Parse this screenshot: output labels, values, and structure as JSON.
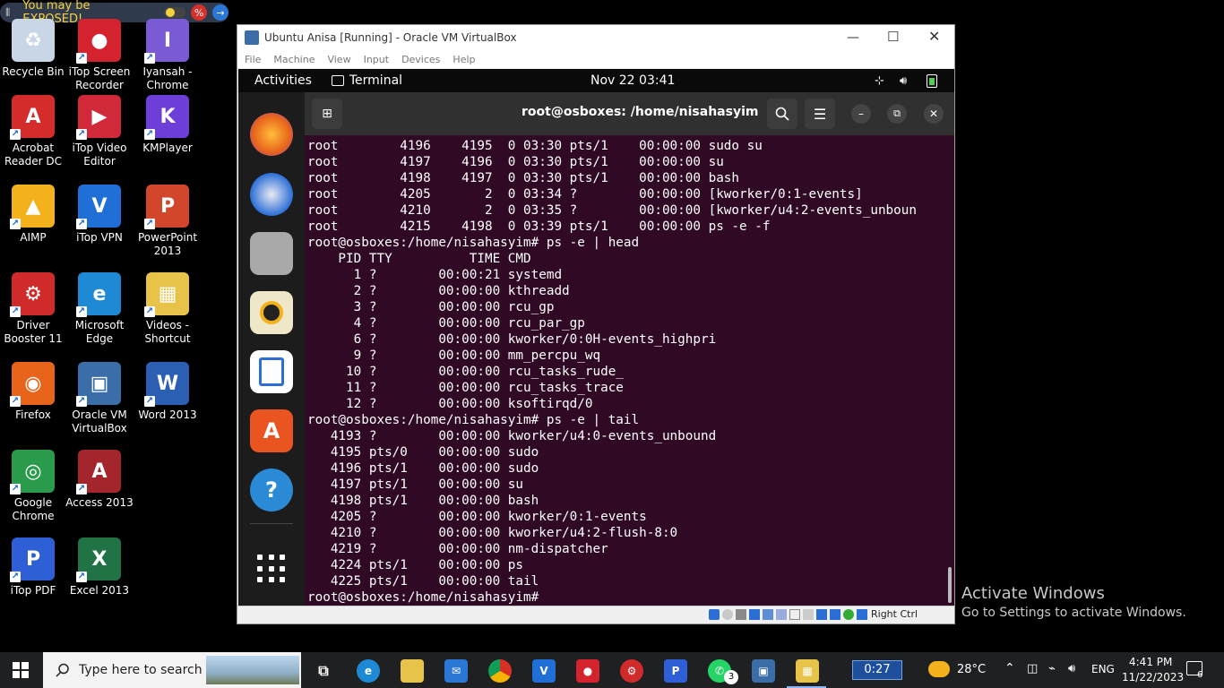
{
  "exposed_bar": {
    "text": "You may be EXPOSED!"
  },
  "desktop_icons": [
    {
      "label": "Recycle Bin",
      "glyph": "♻",
      "color": "#c9d6e6",
      "icon": "recycle-bin-icon"
    },
    {
      "label": "iTop Screen Recorder",
      "glyph": "●",
      "color": "#d4232e",
      "icon": "screen-recorder-icon"
    },
    {
      "label": "Iyansah - Chrome",
      "glyph": "I",
      "color": "#7b5ad6",
      "icon": "chrome-profile-icon"
    },
    {
      "label": "Acrobat Reader DC",
      "glyph": "A",
      "color": "#d42b2b",
      "icon": "acrobat-icon"
    },
    {
      "label": "iTop Video Editor",
      "glyph": "▶",
      "color": "#d02a3a",
      "icon": "video-editor-icon"
    },
    {
      "label": "KMPlayer",
      "glyph": "K",
      "color": "#6d3fd8",
      "icon": "kmplayer-icon"
    },
    {
      "label": "AIMP",
      "glyph": "▲",
      "color": "#f3b21c",
      "icon": "aimp-icon"
    },
    {
      "label": "iTop VPN",
      "glyph": "V",
      "color": "#1f6fd6",
      "icon": "vpn-icon"
    },
    {
      "label": "PowerPoint 2013",
      "glyph": "P",
      "color": "#d2462b",
      "icon": "powerpoint-icon"
    },
    {
      "label": "Driver Booster 11",
      "glyph": "⚙",
      "color": "#d12a2a",
      "icon": "driver-booster-icon"
    },
    {
      "label": "Microsoft Edge",
      "glyph": "e",
      "color": "#1e8ad6",
      "icon": "edge-icon"
    },
    {
      "label": "Videos - Shortcut",
      "glyph": "▦",
      "color": "#e7c34a",
      "icon": "videos-folder-icon"
    },
    {
      "label": "Firefox",
      "glyph": "◉",
      "color": "#e8641b",
      "icon": "firefox-icon"
    },
    {
      "label": "Oracle VM VirtualBox",
      "glyph": "▣",
      "color": "#3b6ea8",
      "icon": "virtualbox-icon"
    },
    {
      "label": "Word 2013",
      "glyph": "W",
      "color": "#2b5fb3",
      "icon": "word-icon"
    },
    {
      "label": "Google Chrome",
      "glyph": "◎",
      "color": "#2a9b4a",
      "icon": "chrome-icon"
    },
    {
      "label": "Access 2013",
      "glyph": "A",
      "color": "#a4262c",
      "icon": "access-icon"
    },
    {
      "label": "",
      "glyph": "",
      "color": "",
      "icon": ""
    },
    {
      "label": "iTop PDF",
      "glyph": "P",
      "color": "#2f5fd6",
      "icon": "pdf-icon"
    },
    {
      "label": "Excel 2013",
      "glyph": "X",
      "color": "#217346",
      "icon": "excel-icon"
    }
  ],
  "vm_window": {
    "title": "Ubuntu Anisa [Running] - Oracle VM VirtualBox",
    "menu": [
      "File",
      "Machine",
      "View",
      "Input",
      "Devices",
      "Help"
    ],
    "status_right": "Right Ctrl"
  },
  "guest": {
    "activities": "Activities",
    "app_name": "Terminal",
    "clock": "Nov 22  03:41",
    "terminal_title": "root@osboxes: /home/nisahasyim",
    "lines": [
      "root        4196    4195  0 03:30 pts/1    00:00:00 sudo su",
      "root        4197    4196  0 03:30 pts/1    00:00:00 su",
      "root        4198    4197  0 03:30 pts/1    00:00:00 bash",
      "root        4205       2  0 03:34 ?        00:00:00 [kworker/0:1-events]",
      "root        4210       2  0 03:35 ?        00:00:00 [kworker/u4:2-events_unboun",
      "root        4215    4198  0 03:39 pts/1    00:00:00 ps -e -f",
      "root@osboxes:/home/nisahasyim# ps -e | head",
      "    PID TTY          TIME CMD",
      "      1 ?        00:00:21 systemd",
      "      2 ?        00:00:00 kthreadd",
      "      3 ?        00:00:00 rcu_gp",
      "      4 ?        00:00:00 rcu_par_gp",
      "      6 ?        00:00:00 kworker/0:0H-events_highpri",
      "      9 ?        00:00:00 mm_percpu_wq",
      "     10 ?        00:00:00 rcu_tasks_rude_",
      "     11 ?        00:00:00 rcu_tasks_trace",
      "     12 ?        00:00:00 ksoftirqd/0",
      "root@osboxes:/home/nisahasyim# ps -e | tail",
      "   4193 ?        00:00:00 kworker/u4:0-events_unbound",
      "   4195 pts/0    00:00:00 sudo",
      "   4196 pts/1    00:00:00 sudo",
      "   4197 pts/1    00:00:00 su",
      "   4198 pts/1    00:00:00 bash",
      "   4205 ?        00:00:00 kworker/0:1-events",
      "   4210 ?        00:00:00 kworker/u4:2-flush-8:0",
      "   4219 ?        00:00:00 nm-dispatcher",
      "   4224 pts/1    00:00:00 ps",
      "   4225 pts/1    00:00:00 tail",
      "root@osboxes:/home/nisahasyim# "
    ]
  },
  "activate": {
    "title": "Activate Windows",
    "subtitle": "Go to Settings to activate Windows."
  },
  "taskbar": {
    "search_placeholder": "Type here to search",
    "timer": "0:27",
    "weather": "28°C",
    "language": "ENG",
    "time": "4:41 PM",
    "date": "11/22/2023",
    "whatsapp_badge": "3",
    "notifications": "6"
  }
}
